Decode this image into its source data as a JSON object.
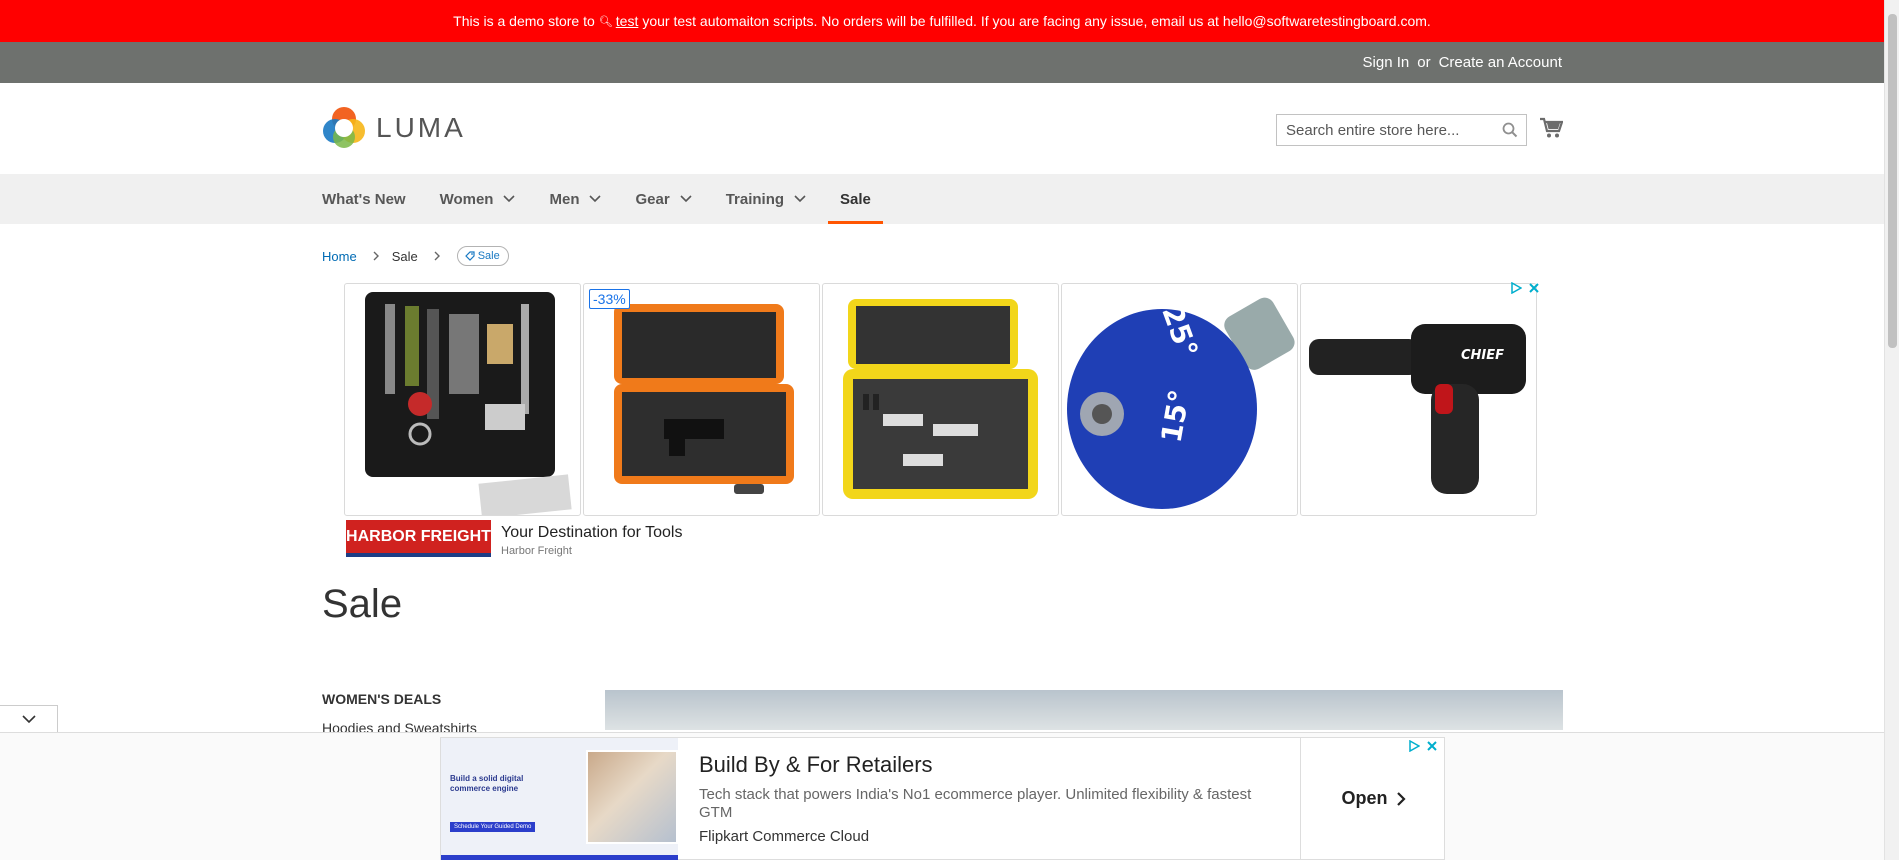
{
  "demo_banner": {
    "text_before": "This is a demo store to",
    "link_word": "test",
    "text_after": "your test automaiton scripts. No orders will be fulfilled. If you are facing any issue, email us at hello@softwaretestingboard.com."
  },
  "header": {
    "sign_in": "Sign In",
    "or": "or",
    "create_account": "Create an Account",
    "logo_text": "LUMA",
    "search_placeholder": "Search entire store here...",
    "search_value": ""
  },
  "nav": {
    "items": [
      {
        "label": "What's New",
        "has_dropdown": false
      },
      {
        "label": "Women",
        "has_dropdown": true
      },
      {
        "label": "Men",
        "has_dropdown": true
      },
      {
        "label": "Gear",
        "has_dropdown": true
      },
      {
        "label": "Training",
        "has_dropdown": true
      },
      {
        "label": "Sale",
        "has_dropdown": false,
        "active": true
      }
    ]
  },
  "breadcrumbs": {
    "home": "Home",
    "current": "Sale",
    "pill": "Sale"
  },
  "ad_top": {
    "badge": "-33%",
    "advertiser_logo": "HARBOR FREIGHT",
    "title": "Your Destination for Tools",
    "advertiser": "Harbor Freight",
    "tile_labels": {
      "torque_high": "25°",
      "torque_low": "15°",
      "brand": "CHIEF"
    }
  },
  "page": {
    "title": "Sale"
  },
  "sidebar": {
    "section_title": "WOMEN'S DEALS",
    "link": "Hoodies and Sweatshirts"
  },
  "bottom_ad": {
    "thumb_heading": "Build a solid digital commerce engine",
    "thumb_button": "Schedule Your Guided Demo",
    "title": "Build By & For Retailers",
    "description": "Tech stack that powers India's No1 ecommerce player. Unlimited flexibility & fastest GTM",
    "advertiser": "Flipkart Commerce Cloud",
    "cta": "Open"
  },
  "colors": {
    "banner": "#ff0000",
    "panel": "#6e716e",
    "nav_bg": "#f0f0f0",
    "active_underline": "#ff5501",
    "link": "#006bb4"
  }
}
